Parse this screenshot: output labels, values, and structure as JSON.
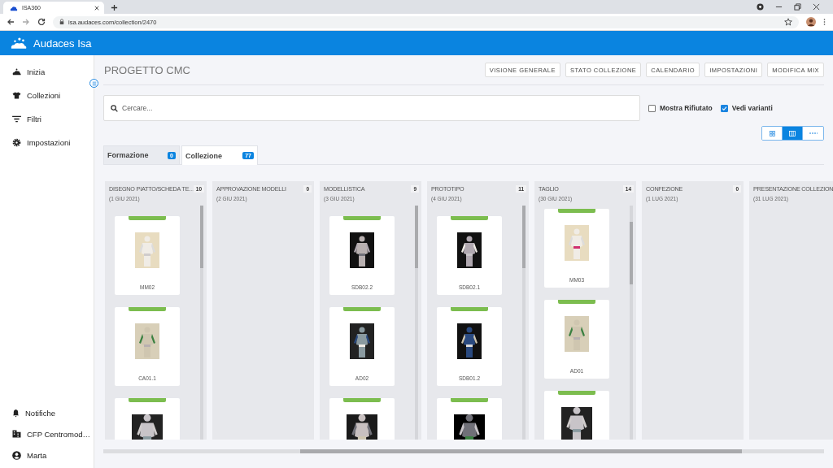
{
  "browser": {
    "tab_title": "ISA360",
    "url": "isa.audaces.com/collection/2470"
  },
  "app_bar": {
    "title": "Audaces Isa"
  },
  "sidebar": {
    "items": [
      {
        "label": "Inizia"
      },
      {
        "label": "Collezioni"
      },
      {
        "label": "Filtri"
      },
      {
        "label": "Impostazioni"
      }
    ],
    "footer_items": [
      {
        "label": "Notifiche"
      },
      {
        "label": "CFP Centromod…"
      },
      {
        "label": "Marta"
      }
    ]
  },
  "page": {
    "title": "PROGETTO CMC",
    "actions": [
      "VISIONE GENERALE",
      "STATO COLLEZIONE",
      "CALENDARIO",
      "IMPOSTAZIONI",
      "MODIFICA MIX"
    ]
  },
  "search": {
    "placeholder": "Cercare..."
  },
  "filters": [
    {
      "label": "Mostra Rifiutato",
      "checked": false
    },
    {
      "label": "Vedi varianti",
      "checked": true
    }
  ],
  "view_modes": [
    {
      "selected": false
    },
    {
      "selected": true
    },
    {
      "selected": false
    }
  ],
  "tabs": [
    {
      "label": "Formazione",
      "count": "0",
      "selected": false
    },
    {
      "label": "Collezione",
      "count": "77",
      "selected": true
    }
  ],
  "columns": [
    {
      "title": "DISEGNO PIATTO/SCHEDA TE…",
      "date": "(1 GIU 2021)",
      "count": "10",
      "cards": [
        {
          "kind": "picture",
          "label": "MM02"
        },
        {
          "kind": "picture",
          "label": "CA01.1"
        },
        {
          "kind": "picture"
        }
      ]
    },
    {
      "title": "APPROVAZIONE MODELLI",
      "date": "(2 GIU 2021)",
      "count": "0"
    },
    {
      "title": "MODELLISTICA",
      "date": "(3 GIU 2021)",
      "count": "9",
      "cards": [
        {
          "kind": "picture",
          "label": "SDB02.2"
        },
        {
          "kind": "picture",
          "label": "AD02"
        },
        {
          "kind": "picture"
        }
      ]
    },
    {
      "title": "PROTOTIPO",
      "date": "(4 GIU 2021)",
      "count": "11",
      "cards": [
        {
          "kind": "picture",
          "label": "SDB02.1"
        },
        {
          "kind": "picture",
          "label": "SDB01.2"
        },
        {
          "kind": "picture"
        }
      ]
    },
    {
      "title": "TAGLIO",
      "date": "(30 GIU 2021)",
      "count": "14",
      "cards": [
        {
          "kind": "picture",
          "label": "MM03"
        },
        {
          "kind": "picture",
          "label": "AD01"
        },
        {
          "kind": "picture"
        }
      ]
    },
    {
      "title": "CONFEZIONE",
      "date": "(1 LUG 2021)",
      "count": "0"
    },
    {
      "title": "PRESENTAZIONE COLLEZION",
      "date": "(31 LUG 2021)"
    }
  ]
}
